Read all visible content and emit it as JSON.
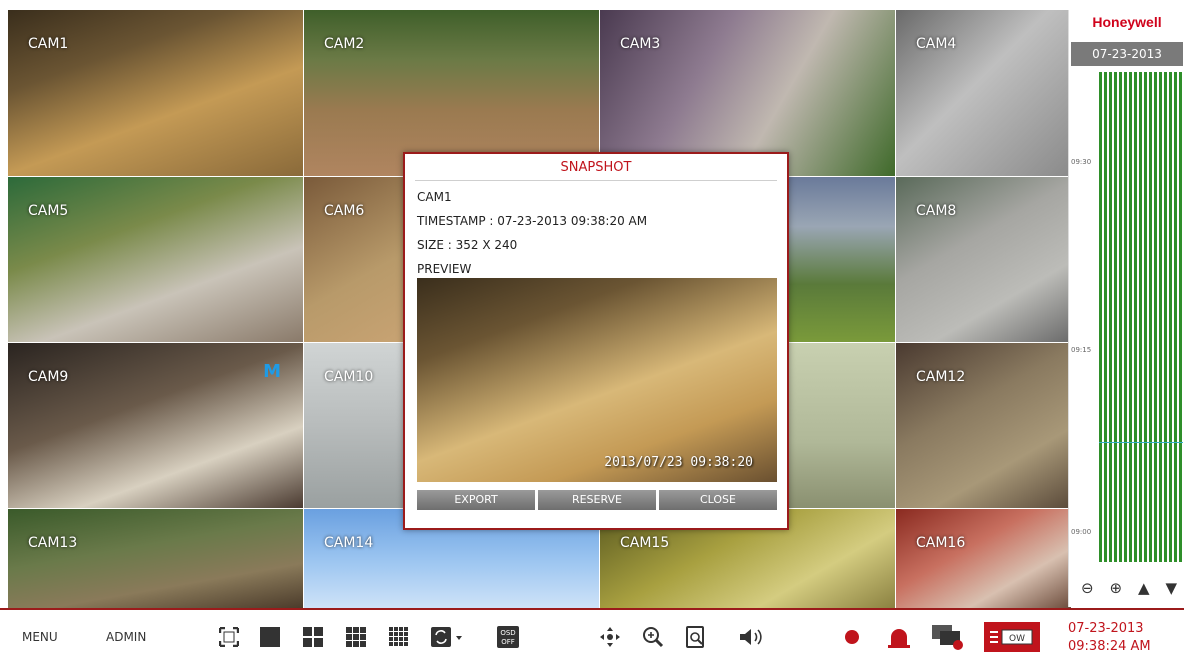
{
  "cameras": [
    {
      "label": "CAM1",
      "marker": ""
    },
    {
      "label": "CAM2",
      "marker": ""
    },
    {
      "label": "CAM3",
      "marker": ""
    },
    {
      "label": "CAM4",
      "marker": ""
    },
    {
      "label": "CAM5",
      "marker": ""
    },
    {
      "label": "CAM6",
      "marker": ""
    },
    {
      "label": "",
      "marker": ""
    },
    {
      "label": "CAM8",
      "marker": ""
    },
    {
      "label": "CAM9",
      "marker": "M"
    },
    {
      "label": "CAM10",
      "marker": ""
    },
    {
      "label": "",
      "marker": ""
    },
    {
      "label": "CAM12",
      "marker": ""
    },
    {
      "label": "CAM13",
      "marker": ""
    },
    {
      "label": "CAM14",
      "marker": ""
    },
    {
      "label": "CAM15",
      "marker": ""
    },
    {
      "label": "CAM16",
      "marker": ""
    }
  ],
  "timeline": {
    "brand": "Honeywell",
    "date": "07-23-2013",
    "ticks": [
      "09:30",
      "09:15",
      "09:00"
    ]
  },
  "dialog": {
    "title": "SNAPSHOT",
    "camera": "CAM1",
    "timestamp": "TIMESTAMP : 07-23-2013  09:38:20 AM",
    "size": "SIZE : 352 X 240",
    "preview_label": "PREVIEW",
    "preview_overlay": "2013/07/23 09:38:20",
    "buttons": {
      "export": "EXPORT",
      "reserve": "RESERVE",
      "close": "CLOSE"
    }
  },
  "bottombar": {
    "menu": "MENU",
    "admin": "ADMIN",
    "osd": "OSD OFF",
    "date": "07-23-2013",
    "time": "09:38:24 AM",
    "colors": {
      "accent": "#c0141c",
      "icon": "#333333"
    }
  }
}
